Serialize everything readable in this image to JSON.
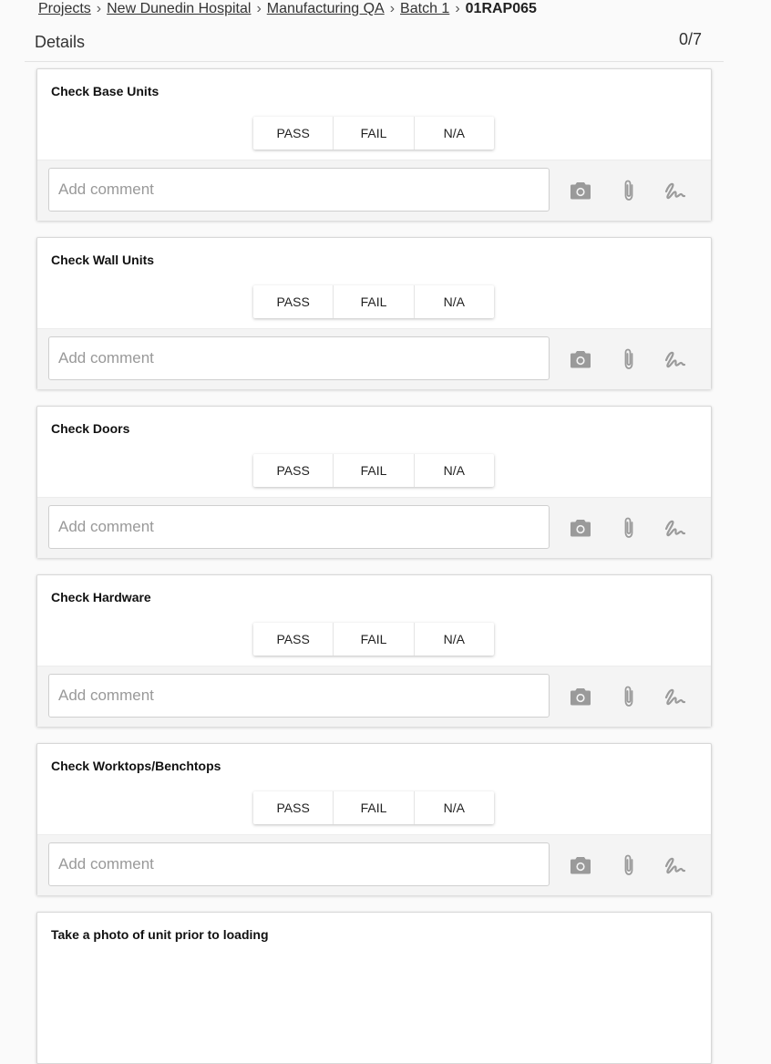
{
  "breadcrumb": {
    "items": [
      "Projects",
      "New Dunedin Hospital",
      "Manufacturing QA",
      "Batch 1"
    ],
    "current": "01RAP065"
  },
  "details": {
    "title": "Details",
    "count": "0/7"
  },
  "options": {
    "pass": "PASS",
    "fail": "FAIL",
    "na": "N/A"
  },
  "comment_placeholder": "Add comment",
  "icons": [
    "camera-icon",
    "paperclip-icon",
    "signature-icon"
  ],
  "checks": [
    {
      "title": "Check Base Units"
    },
    {
      "title": "Check Wall Units"
    },
    {
      "title": "Check Doors"
    },
    {
      "title": "Check Hardware"
    },
    {
      "title": "Check Worktops/Benchtops"
    },
    {
      "title": "Take a photo of unit prior to loading"
    }
  ]
}
